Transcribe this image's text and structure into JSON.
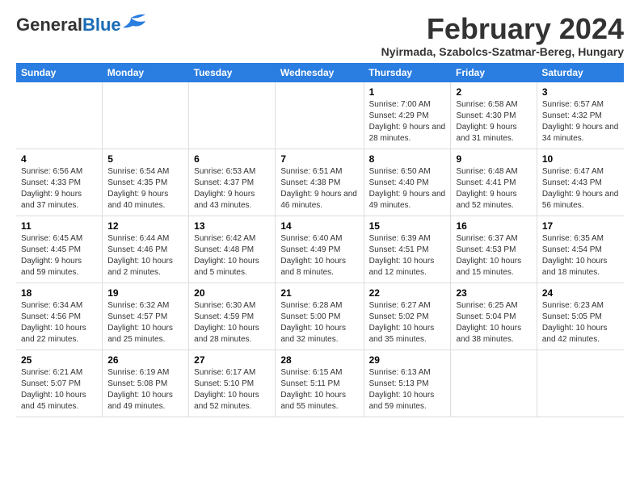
{
  "logo": {
    "general": "General",
    "blue": "Blue"
  },
  "header": {
    "month_year": "February 2024",
    "location": "Nyirmada, Szabolcs-Szatmar-Bereg, Hungary"
  },
  "days_of_week": [
    "Sunday",
    "Monday",
    "Tuesday",
    "Wednesday",
    "Thursday",
    "Friday",
    "Saturday"
  ],
  "weeks": [
    [
      {
        "day": "",
        "sunrise": "",
        "sunset": "",
        "daylight": "",
        "empty": true
      },
      {
        "day": "",
        "sunrise": "",
        "sunset": "",
        "daylight": "",
        "empty": true
      },
      {
        "day": "",
        "sunrise": "",
        "sunset": "",
        "daylight": "",
        "empty": true
      },
      {
        "day": "",
        "sunrise": "",
        "sunset": "",
        "daylight": "",
        "empty": true
      },
      {
        "day": "1",
        "sunrise": "Sunrise: 7:00 AM",
        "sunset": "Sunset: 4:29 PM",
        "daylight": "Daylight: 9 hours and 28 minutes."
      },
      {
        "day": "2",
        "sunrise": "Sunrise: 6:58 AM",
        "sunset": "Sunset: 4:30 PM",
        "daylight": "Daylight: 9 hours and 31 minutes."
      },
      {
        "day": "3",
        "sunrise": "Sunrise: 6:57 AM",
        "sunset": "Sunset: 4:32 PM",
        "daylight": "Daylight: 9 hours and 34 minutes."
      }
    ],
    [
      {
        "day": "4",
        "sunrise": "Sunrise: 6:56 AM",
        "sunset": "Sunset: 4:33 PM",
        "daylight": "Daylight: 9 hours and 37 minutes."
      },
      {
        "day": "5",
        "sunrise": "Sunrise: 6:54 AM",
        "sunset": "Sunset: 4:35 PM",
        "daylight": "Daylight: 9 hours and 40 minutes."
      },
      {
        "day": "6",
        "sunrise": "Sunrise: 6:53 AM",
        "sunset": "Sunset: 4:37 PM",
        "daylight": "Daylight: 9 hours and 43 minutes."
      },
      {
        "day": "7",
        "sunrise": "Sunrise: 6:51 AM",
        "sunset": "Sunset: 4:38 PM",
        "daylight": "Daylight: 9 hours and 46 minutes."
      },
      {
        "day": "8",
        "sunrise": "Sunrise: 6:50 AM",
        "sunset": "Sunset: 4:40 PM",
        "daylight": "Daylight: 9 hours and 49 minutes."
      },
      {
        "day": "9",
        "sunrise": "Sunrise: 6:48 AM",
        "sunset": "Sunset: 4:41 PM",
        "daylight": "Daylight: 9 hours and 52 minutes."
      },
      {
        "day": "10",
        "sunrise": "Sunrise: 6:47 AM",
        "sunset": "Sunset: 4:43 PM",
        "daylight": "Daylight: 9 hours and 56 minutes."
      }
    ],
    [
      {
        "day": "11",
        "sunrise": "Sunrise: 6:45 AM",
        "sunset": "Sunset: 4:45 PM",
        "daylight": "Daylight: 9 hours and 59 minutes."
      },
      {
        "day": "12",
        "sunrise": "Sunrise: 6:44 AM",
        "sunset": "Sunset: 4:46 PM",
        "daylight": "Daylight: 10 hours and 2 minutes."
      },
      {
        "day": "13",
        "sunrise": "Sunrise: 6:42 AM",
        "sunset": "Sunset: 4:48 PM",
        "daylight": "Daylight: 10 hours and 5 minutes."
      },
      {
        "day": "14",
        "sunrise": "Sunrise: 6:40 AM",
        "sunset": "Sunset: 4:49 PM",
        "daylight": "Daylight: 10 hours and 8 minutes."
      },
      {
        "day": "15",
        "sunrise": "Sunrise: 6:39 AM",
        "sunset": "Sunset: 4:51 PM",
        "daylight": "Daylight: 10 hours and 12 minutes."
      },
      {
        "day": "16",
        "sunrise": "Sunrise: 6:37 AM",
        "sunset": "Sunset: 4:53 PM",
        "daylight": "Daylight: 10 hours and 15 minutes."
      },
      {
        "day": "17",
        "sunrise": "Sunrise: 6:35 AM",
        "sunset": "Sunset: 4:54 PM",
        "daylight": "Daylight: 10 hours and 18 minutes."
      }
    ],
    [
      {
        "day": "18",
        "sunrise": "Sunrise: 6:34 AM",
        "sunset": "Sunset: 4:56 PM",
        "daylight": "Daylight: 10 hours and 22 minutes."
      },
      {
        "day": "19",
        "sunrise": "Sunrise: 6:32 AM",
        "sunset": "Sunset: 4:57 PM",
        "daylight": "Daylight: 10 hours and 25 minutes."
      },
      {
        "day": "20",
        "sunrise": "Sunrise: 6:30 AM",
        "sunset": "Sunset: 4:59 PM",
        "daylight": "Daylight: 10 hours and 28 minutes."
      },
      {
        "day": "21",
        "sunrise": "Sunrise: 6:28 AM",
        "sunset": "Sunset: 5:00 PM",
        "daylight": "Daylight: 10 hours and 32 minutes."
      },
      {
        "day": "22",
        "sunrise": "Sunrise: 6:27 AM",
        "sunset": "Sunset: 5:02 PM",
        "daylight": "Daylight: 10 hours and 35 minutes."
      },
      {
        "day": "23",
        "sunrise": "Sunrise: 6:25 AM",
        "sunset": "Sunset: 5:04 PM",
        "daylight": "Daylight: 10 hours and 38 minutes."
      },
      {
        "day": "24",
        "sunrise": "Sunrise: 6:23 AM",
        "sunset": "Sunset: 5:05 PM",
        "daylight": "Daylight: 10 hours and 42 minutes."
      }
    ],
    [
      {
        "day": "25",
        "sunrise": "Sunrise: 6:21 AM",
        "sunset": "Sunset: 5:07 PM",
        "daylight": "Daylight: 10 hours and 45 minutes."
      },
      {
        "day": "26",
        "sunrise": "Sunrise: 6:19 AM",
        "sunset": "Sunset: 5:08 PM",
        "daylight": "Daylight: 10 hours and 49 minutes."
      },
      {
        "day": "27",
        "sunrise": "Sunrise: 6:17 AM",
        "sunset": "Sunset: 5:10 PM",
        "daylight": "Daylight: 10 hours and 52 minutes."
      },
      {
        "day": "28",
        "sunrise": "Sunrise: 6:15 AM",
        "sunset": "Sunset: 5:11 PM",
        "daylight": "Daylight: 10 hours and 55 minutes."
      },
      {
        "day": "29",
        "sunrise": "Sunrise: 6:13 AM",
        "sunset": "Sunset: 5:13 PM",
        "daylight": "Daylight: 10 hours and 59 minutes."
      },
      {
        "day": "",
        "sunrise": "",
        "sunset": "",
        "daylight": "",
        "empty": true
      },
      {
        "day": "",
        "sunrise": "",
        "sunset": "",
        "daylight": "",
        "empty": true
      }
    ]
  ]
}
